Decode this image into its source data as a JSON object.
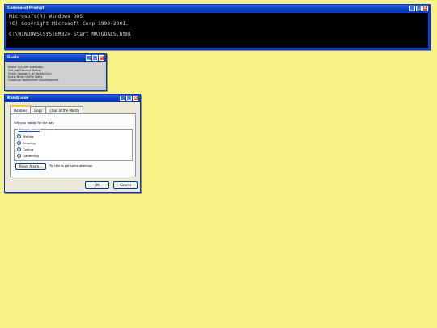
{
  "windows": {
    "cmd": {
      "title": "Command Prompt",
      "line1": "Microsoft(R) Windows DOS",
      "line2": "(C) Copyright Microsoft Corp 1990-2001.",
      "line3": "C:\\WINDOWS\\SYSTEM32> Start MAYGOALS.html"
    },
    "goals": {
      "title": "Goals",
      "items": [
        "Stand 5/22/09 everyday",
        "Get Job Resume Ready",
        "Finish Season 1 of Family Guy",
        "Draw Brian Griffin Daily",
        "Continue Webscreen Development"
      ]
    },
    "randy": {
      "title": "Randy.exe",
      "tabs": [
        "Hobbies",
        "Dogs",
        "Chas of the Month"
      ],
      "hobby_prompt": "Set your hobby for the day.",
      "group_title": "Today's mood",
      "options": [
        "Writing",
        "Drawing",
        "Coding",
        "Gardening"
      ],
      "reset_label": "Reset Alarm...",
      "hint_text": "Try this to get some attention",
      "ok_label": "OK",
      "cancel_label": "Cancel"
    }
  },
  "controls": {
    "minimize": "_",
    "maximize": "□",
    "close": "x"
  },
  "colors": {
    "desktop": "#f7f286",
    "titlebar": "#0a3fc2",
    "console_bg": "#000000"
  }
}
